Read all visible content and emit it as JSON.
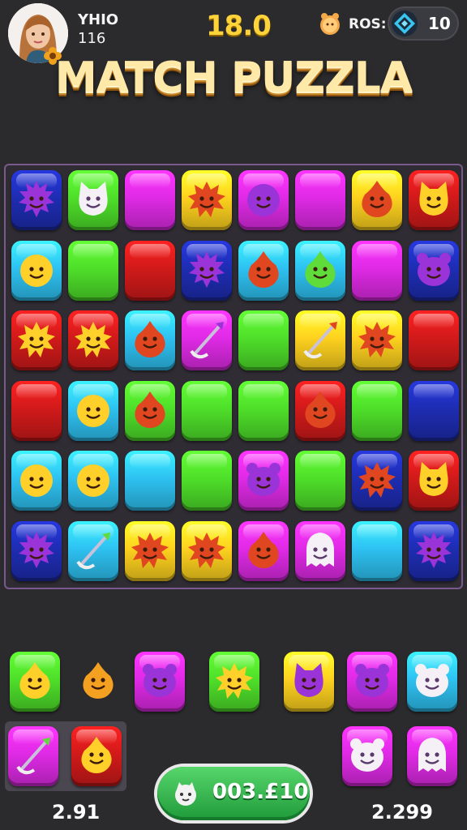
{
  "hud": {
    "player_name": "YHIO",
    "player_level": "116",
    "score": "18.0",
    "ros_label": "ROS:",
    "gem_count": "10"
  },
  "title": "MATCH PUZZLA",
  "colors": {
    "red": "#d21a1a",
    "green": "#4fe02a",
    "blue": "#1e2db3",
    "cyan": "#2ec2f2",
    "magenta": "#e02ae6",
    "yellow": "#ffd21f",
    "background": "#2b2b2d",
    "board_border": "#7a5a8e"
  },
  "board": {
    "rows": [
      [
        {
          "c": "blue",
          "icon": "purple-spiky-monster"
        },
        {
          "c": "green",
          "icon": "white-cat-monster"
        },
        {
          "c": "magenta",
          "icon": ""
        },
        {
          "c": "yellow",
          "icon": "red-sun-monster"
        },
        {
          "c": "magenta",
          "icon": "purple-blob-monster"
        },
        {
          "c": "magenta",
          "icon": ""
        },
        {
          "c": "yellow",
          "icon": "red-flame-monster"
        },
        {
          "c": "red",
          "icon": "yellow-cat-monster"
        }
      ],
      [
        {
          "c": "cyan",
          "icon": "yellow-blob-monster"
        },
        {
          "c": "green",
          "icon": ""
        },
        {
          "c": "red",
          "icon": ""
        },
        {
          "c": "blue",
          "icon": "purple-spiky-monster"
        },
        {
          "c": "cyan",
          "icon": "red-flame-monster"
        },
        {
          "c": "cyan",
          "icon": "green-drop-monster"
        },
        {
          "c": "magenta",
          "icon": ""
        },
        {
          "c": "blue",
          "icon": "purple-bear-monster"
        }
      ],
      [
        {
          "c": "red",
          "icon": "yellow-sun-monster"
        },
        {
          "c": "red",
          "icon": "yellow-sun-monster"
        },
        {
          "c": "cyan",
          "icon": "red-flame-monster"
        },
        {
          "c": "magenta",
          "icon": "purple-spear-item"
        },
        {
          "c": "green",
          "icon": ""
        },
        {
          "c": "yellow",
          "icon": "red-trident-item"
        },
        {
          "c": "yellow",
          "icon": "red-sun-monster"
        },
        {
          "c": "red",
          "icon": ""
        }
      ],
      [
        {
          "c": "red",
          "icon": ""
        },
        {
          "c": "cyan",
          "icon": "yellow-blob-monster"
        },
        {
          "c": "green",
          "icon": "red-flame-monster"
        },
        {
          "c": "green",
          "icon": ""
        },
        {
          "c": "green",
          "icon": ""
        },
        {
          "c": "red",
          "icon": "red-flame-monster"
        },
        {
          "c": "green",
          "icon": ""
        },
        {
          "c": "blue",
          "icon": ""
        }
      ],
      [
        {
          "c": "cyan",
          "icon": "yellow-blob-monster"
        },
        {
          "c": "cyan",
          "icon": "yellow-blob-monster"
        },
        {
          "c": "cyan",
          "icon": ""
        },
        {
          "c": "green",
          "icon": ""
        },
        {
          "c": "magenta",
          "icon": "purple-bear-monster"
        },
        {
          "c": "green",
          "icon": ""
        },
        {
          "c": "blue",
          "icon": "red-sun-monster"
        },
        {
          "c": "red",
          "icon": "yellow-cat-monster"
        }
      ],
      [
        {
          "c": "blue",
          "icon": "purple-spiky-monster"
        },
        {
          "c": "cyan",
          "icon": "green-spear-item"
        },
        {
          "c": "yellow",
          "icon": "red-sun-monster"
        },
        {
          "c": "yellow",
          "icon": "red-sun-monster"
        },
        {
          "c": "magenta",
          "icon": "red-flame-monster"
        },
        {
          "c": "magenta",
          "icon": "white-ghost-monster"
        },
        {
          "c": "cyan",
          "icon": ""
        },
        {
          "c": "blue",
          "icon": "purple-spiky-monster"
        }
      ]
    ]
  },
  "queue": [
    {
      "c": "green",
      "icon": "yellow-drop-monster"
    },
    {
      "c": "none",
      "icon": "orange-drop-monster"
    },
    {
      "c": "magenta",
      "icon": "purple-bear-monster"
    },
    {
      "c": "green",
      "icon": "yellow-sun-monster"
    },
    {
      "c": "yellow",
      "icon": "purple-cat-monster"
    },
    {
      "c": "magenta",
      "icon": "purple-bear-monster"
    },
    {
      "c": "cyan",
      "icon": "white-bear-monster"
    }
  ],
  "tray_left": [
    {
      "c": "magenta",
      "icon": "green-spear-item"
    },
    {
      "c": "red",
      "icon": "yellow-drop-monster"
    }
  ],
  "tray_right": [
    {
      "c": "magenta",
      "icon": "white-bear-monster"
    },
    {
      "c": "magenta",
      "icon": "white-ghost-monster"
    }
  ],
  "bottom": {
    "left_value": "2.91",
    "right_value": "2.299",
    "pill_value": "003.£10"
  }
}
